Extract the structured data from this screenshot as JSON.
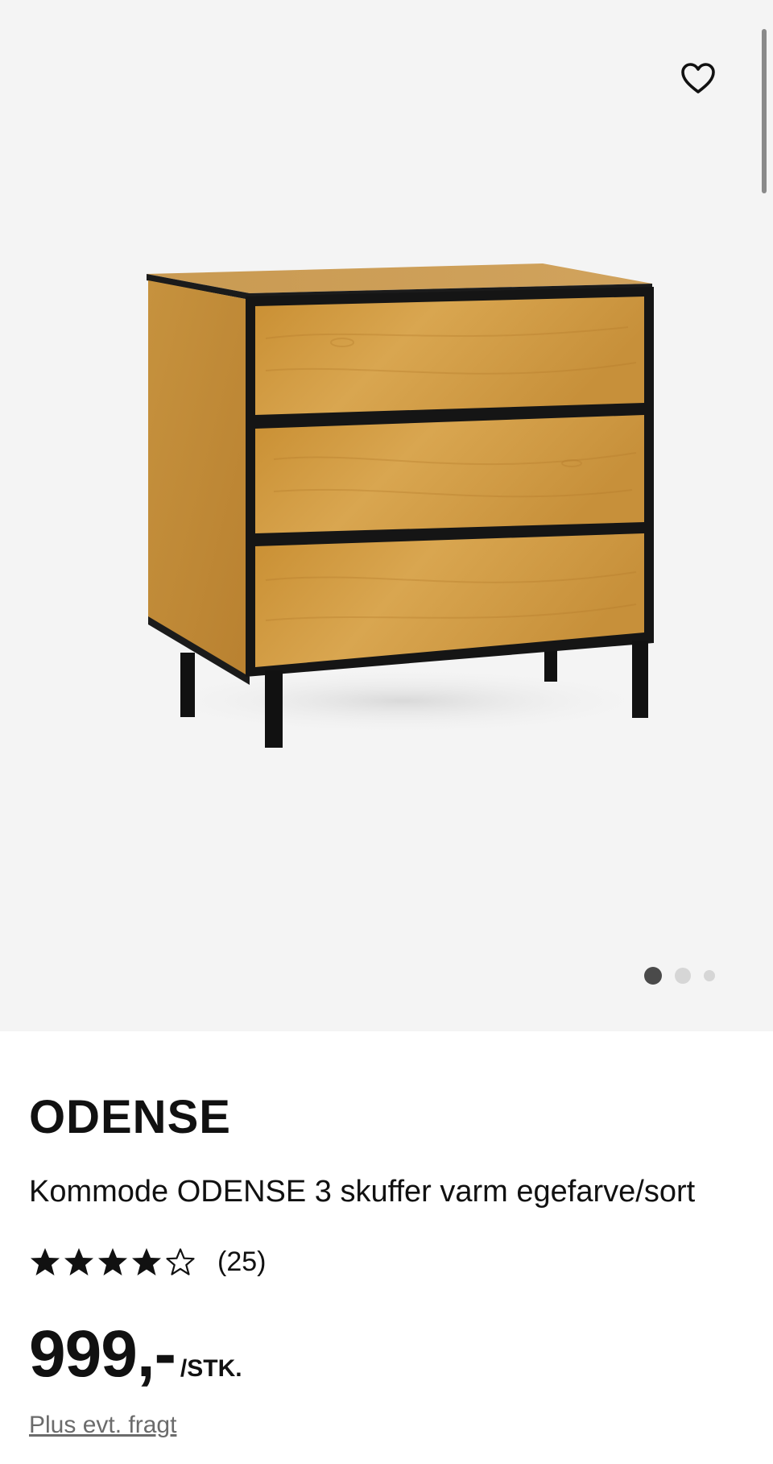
{
  "gallery": {
    "favorite_icon": "heart-outline-icon",
    "image_alt": "Kommode ODENSE 3 skuffer varm egefarve/sort",
    "dots_total": 3,
    "dots_active_index": 0
  },
  "product": {
    "brand": "ODENSE",
    "title": "Kommode ODENSE 3 skuffer varm egefarve/sort",
    "rating": {
      "stars_filled": 4,
      "stars_total": 5,
      "count_label": "(25)"
    },
    "price": "999,-",
    "unit": "/STK.",
    "shipping_link": "Plus evt. fragt"
  },
  "colors": {
    "gallery_bg": "#f4f4f4",
    "text": "#111111",
    "muted": "#6b6b6b",
    "dot_active": "#4a4a4a",
    "dot_inactive": "#d6d6d6",
    "oak": "#c9943e"
  }
}
